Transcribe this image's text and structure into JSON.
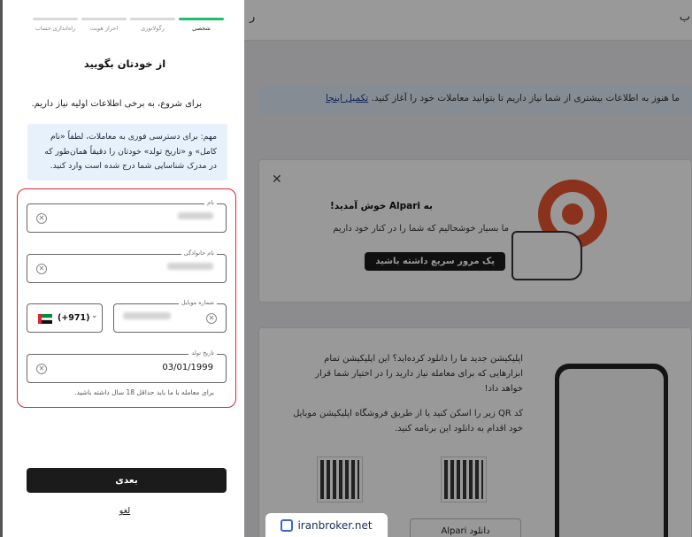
{
  "background": {
    "topbar_left": "ر",
    "topbar_right": "ب",
    "banner_text": "ما هنوز به اطلاعات بیشتری از شما نیاز داریم تا بتوانید معاملات خود را آغاز کنید.",
    "banner_link": "تکمیل اینجا",
    "welcome_title": "به Alpari خوش آمدید!",
    "welcome_sub": "ما بسیار خوشحالیم که شما را در کنار خود داریم",
    "welcome_button": "یک مرور سریع داشته باشید",
    "app_text_1": "اپلیکیشن جدید ما را دانلود کرده‌اید؟ این اپلیکیشن تمام ابزارهایی که برای معامله نیاز دارید را در اختیار شما قرار خواهد داد!",
    "app_text_2": "کد QR زیر را اسکن کنید یا از طریق فروشگاه اپلیکیشن موبایل خود اقدام به دانلود این برنامه کنید.",
    "store_button": "دانلود Alpari"
  },
  "watermark": "iranbroker.net",
  "stepper": [
    {
      "label": "شخصی",
      "active": true
    },
    {
      "label": "رگولاتوری",
      "active": false
    },
    {
      "label": "احراز هویت",
      "active": false
    },
    {
      "label": "راه‌اندازی حساب",
      "active": false
    }
  ],
  "form": {
    "title": "از خودتان بگویید",
    "intro": "برای شروع، به برخی اطلاعات اولیه نیاز داریم.",
    "notice": "مهم: برای دسترسی فوری به معاملات، لطفاً «نام کامل» و «تاریخ تولد» خودتان را دقیقاً همان‌طور که در مدرک شناسایی شما درج شده است وارد کنید.",
    "name_label": "نام",
    "family_label": "نام خانوادگی",
    "phone_label": "شماره موبایل",
    "country_code": "(+971)",
    "birth_label": "تاریخ تولد",
    "birth_value": "03/01/1999",
    "age_hint": "برای معامله با ما باید حداقل 18 سال داشته باشید.",
    "next_button": "بعدی",
    "cancel_link": "لغو"
  },
  "icons": {
    "clear": "clear-icon",
    "chevron": "chevron-down-icon",
    "close": "close-icon"
  }
}
